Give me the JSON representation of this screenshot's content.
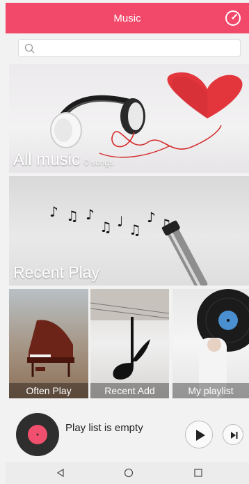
{
  "header": {
    "title": "Music"
  },
  "search": {
    "placeholder": ""
  },
  "tiles": {
    "all_music": {
      "label": "All music",
      "count": "0 songs"
    },
    "recent_play": {
      "label": "Recent Play"
    },
    "often_play": {
      "label": "Often Play"
    },
    "recent_add": {
      "label": "Recent Add"
    },
    "my_playlist": {
      "label": "My playlist"
    }
  },
  "player": {
    "status": "Play list is empty"
  },
  "colors": {
    "accent": "#f2486a",
    "disc_label": "#f0506e"
  },
  "icons": [
    "timer-icon",
    "search-icon",
    "play-icon",
    "next-icon",
    "back-icon",
    "home-icon",
    "recents-icon"
  ]
}
